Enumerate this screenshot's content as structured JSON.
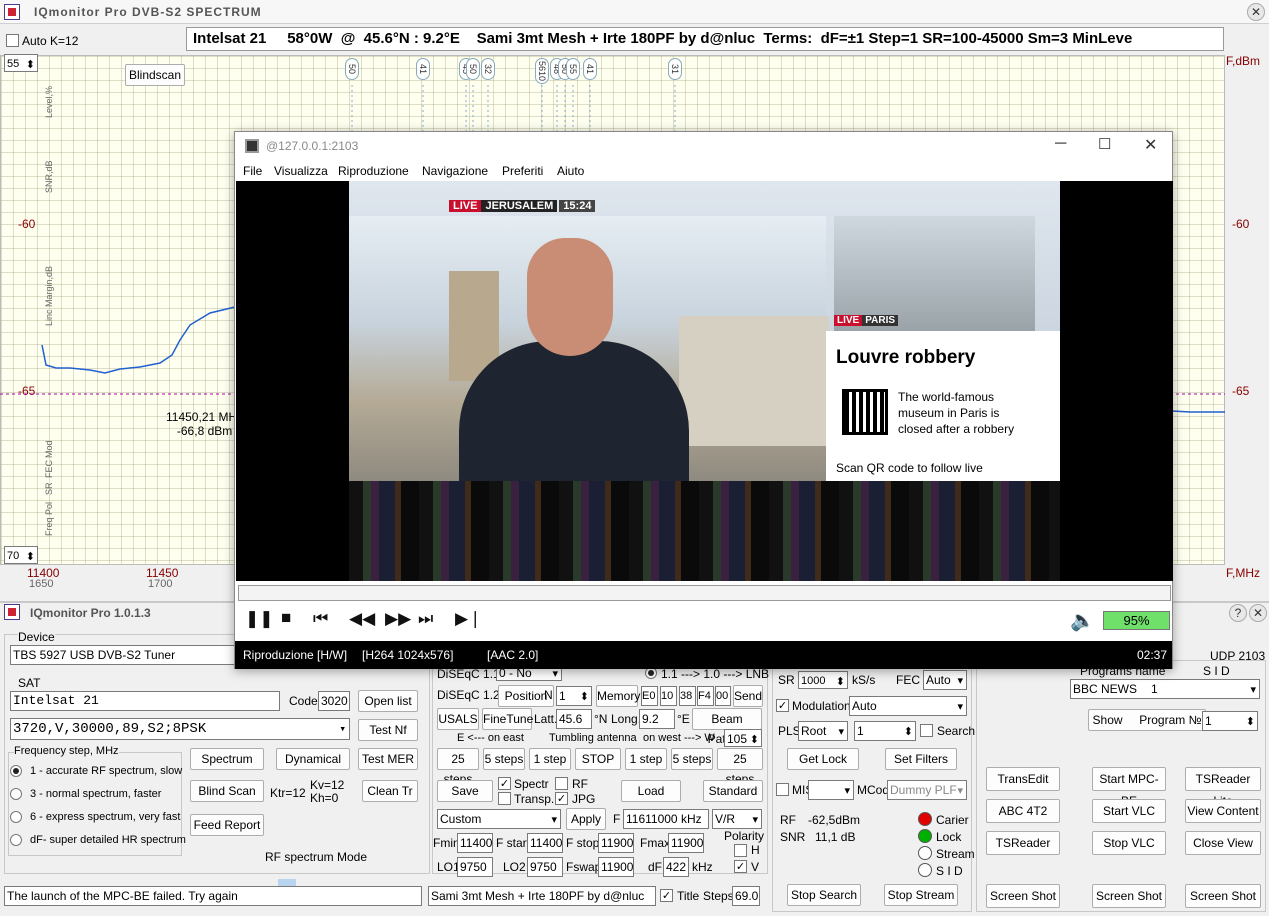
{
  "spectrum_window": {
    "title": "IQmonitor Pro  DVB-S2  SPECTRUM",
    "auto_k_label": "Auto K=12",
    "info_banner": "Intelsat 21     58°0W  @  45.6°N : 9.2°E    Sami 3mt Mesh + Irte 180PF by d@nluc  Terms:  dF=±1 Step=1 SR=100-45000 Sm=3 MinLeve",
    "level_top": "55",
    "level_bottom": "70",
    "blindscan_label": "Blindscan",
    "right_unit_label": "F,dBm",
    "y_left_labels": [
      "-60",
      "-65"
    ],
    "y_right_labels": [
      "-60",
      "-65"
    ],
    "axis_texts": {
      "level": "Level,%",
      "snr": "SNR,dB",
      "link_margin": "Linc Margin,dB",
      "mod": "Mod",
      "fec": "FEC",
      "sr": "SR",
      "pol": "Pol",
      "freq": "Freq"
    },
    "cursor_readout": {
      "freq": "11450,21 MHz",
      "level": "-66,8 dBm"
    },
    "x_axis": {
      "ticks": [
        "11400",
        "11450"
      ],
      "sub_ticks": [
        "1650",
        "1700"
      ],
      "unit": "F,MHz"
    },
    "markers": [
      "50",
      "41",
      "45",
      "50",
      "32",
      "5610",
      "48",
      "50",
      "55",
      "41",
      "31"
    ],
    "colors": {
      "trace": "#2060d0",
      "reference_line": "#b000b0",
      "plot_bg": "#fffff0"
    }
  },
  "vlc": {
    "title": "@127.0.0.1:2103",
    "menu": [
      "File",
      "Visualizza",
      "Riproduzione",
      "Navigazione",
      "Preferiti",
      "Aiuto"
    ],
    "video": {
      "live_badge": "LIVE",
      "location": "JERUSALEM",
      "time": "15:24",
      "side_live_badge": "LIVE",
      "side_location": "PARIS",
      "headline": "Louvre robbery",
      "side_text": "The world-famous museum in Paris is closed after a robbery",
      "scan_text": "Scan QR code to follow live"
    },
    "volume": "95%",
    "status_left": "Riproduzione [H/W]",
    "status_codec_video": "[H264 1024x576]",
    "status_codec_audio": "[AAC 2.0]",
    "status_time": "02:37"
  },
  "control_window": {
    "title": "IQmonitor Pro  1.0.1.3",
    "device": {
      "label": "Device",
      "value": "TBS 5927 USB DVB-S2 Tuner"
    },
    "sat": {
      "label": "SAT",
      "name": "Intelsat 21",
      "code_label": "Code",
      "code": "3020",
      "open_list": "Open list",
      "tp": "3720,V,30000,89,S2;8PSK",
      "test_nf": "Test Nf",
      "test_mer": "Test MER",
      "clean_tr": "Clean Tr"
    },
    "freq_step": {
      "label": "Frequency step, MHz",
      "options": [
        "1 - accurate RF spectrum, slow",
        "3 - normal spectrum, faster",
        "6 - express spectrum, very fast",
        "dF- super detailed HR spectrum"
      ],
      "selected_index": 0
    },
    "buttons": {
      "spectrum": "Spectrum",
      "dynamical": "Dynamical",
      "blind_scan": "Blind Scan",
      "feed_report": "Feed Report",
      "ktr": "Ktr=12",
      "kv": "Kv=12",
      "kh": "Kh=0",
      "rf_mode": "RF spectrum Mode"
    },
    "status_message": "The launch of the MPC-BE failed. Try again",
    "diseqc": {
      "d11_label": "DiSEqC 1.1",
      "d11_value": "0 - No",
      "lnb_label": "1.1 ---> 1.0 ---> LNB",
      "d12_label": "DiSEqC 1.2",
      "position": "Position",
      "n_label": "N",
      "n_value": "1",
      "memory": "Memory",
      "cmd_bytes": [
        "E0",
        "10",
        "38",
        "F4",
        "00"
      ],
      "send": "Send",
      "usals": "USALS",
      "finetune": "FineTune",
      "latt_label": "Latt.",
      "latt": "45.6",
      "n_unit": "°N",
      "long_label": "Long.",
      "long": "9.2",
      "e_unit": "°E",
      "beam_pattern": "Beam Pattern",
      "tumbling_left": "E  <---  on  east",
      "tumbling_mid": "Tumbling antenna",
      "tumbling_right": "on  west  ---> W",
      "tumbling_value": "105",
      "steps": [
        "25 steps",
        "5 steps",
        "1 step",
        "STOP",
        "1 step",
        "5 steps",
        "25 steps"
      ]
    },
    "save_row": {
      "save": "Save",
      "spectr": "Spectr",
      "rf": "RF",
      "transp": "Transp.",
      "jpg": "JPG",
      "load": "Load",
      "standard": "Standard"
    },
    "lnb": {
      "preset": "Custom",
      "apply": "Apply",
      "f_label": "F",
      "f_value": "11611000 kHz",
      "pol": "V/R",
      "fmin_label": "Fmin",
      "fmin": "11400",
      "fstart_label": "F start",
      "fstart": "11400",
      "fstop_label": "F stop",
      "fstop": "11900",
      "fmax_label": "Fmax",
      "fmax": "11900",
      "polarity_label": "Polarity",
      "h_label": "H",
      "v_label": "V",
      "lo1_label": "LO1",
      "lo1": "9750",
      "lo2_label": "LO2",
      "lo2": "9750",
      "fswap_label": "Fswap",
      "fswap": "11900",
      "df_label": "dF",
      "df": "422",
      "khz": "kHz"
    },
    "feed_name": "Sami 3mt Mesh + Irte 180PF by d@nluc",
    "title_label": "Title",
    "steps_label": "Steps",
    "steps_value": "69.0",
    "tuning": {
      "sr_label": "SR",
      "sr": "1000",
      "sr_unit": "kS/s",
      "fec_label": "FEC",
      "fec": "Auto",
      "modulation_label": "Modulation",
      "modulation": "Auto",
      "pls_label": "PLS",
      "pls": "Root",
      "pls_value": "1",
      "search_label": "Search",
      "get_lock": "Get Lock",
      "set_filters": "Set Filters",
      "mis_label": "MIS",
      "mcod_label": "MCod",
      "mcod": "Dummy PLF",
      "rf_label": "RF",
      "rf_value": "-62,5dBm",
      "snr_label": "SNR",
      "snr_value": "11,1 dB",
      "carier": "Carier",
      "lock": "Lock",
      "stream": "Stream",
      "sid": "S I D",
      "stop_search": "Stop Search",
      "stop_stream": "Stop Stream"
    },
    "programs": {
      "udp": "UDP 2103",
      "programs_name": "Programs  name",
      "sid_label": "S I D",
      "program": "BBC NEWS",
      "program_sid": "1",
      "show": "Show",
      "program_label": "Program  №",
      "program_no": "1",
      "transedit": "TransEdit",
      "start_mpc": "Start  MPC-BE",
      "tsreader_lite": "TSReader Lite",
      "abc": "ABC 4T2",
      "start_vlc": "Start  VLC",
      "view_content": "View Content",
      "tsreader": "TSReader",
      "stop_vlc": "Stop  VLC",
      "close_view": "Close View",
      "screenshot": "Screen Shot"
    }
  }
}
